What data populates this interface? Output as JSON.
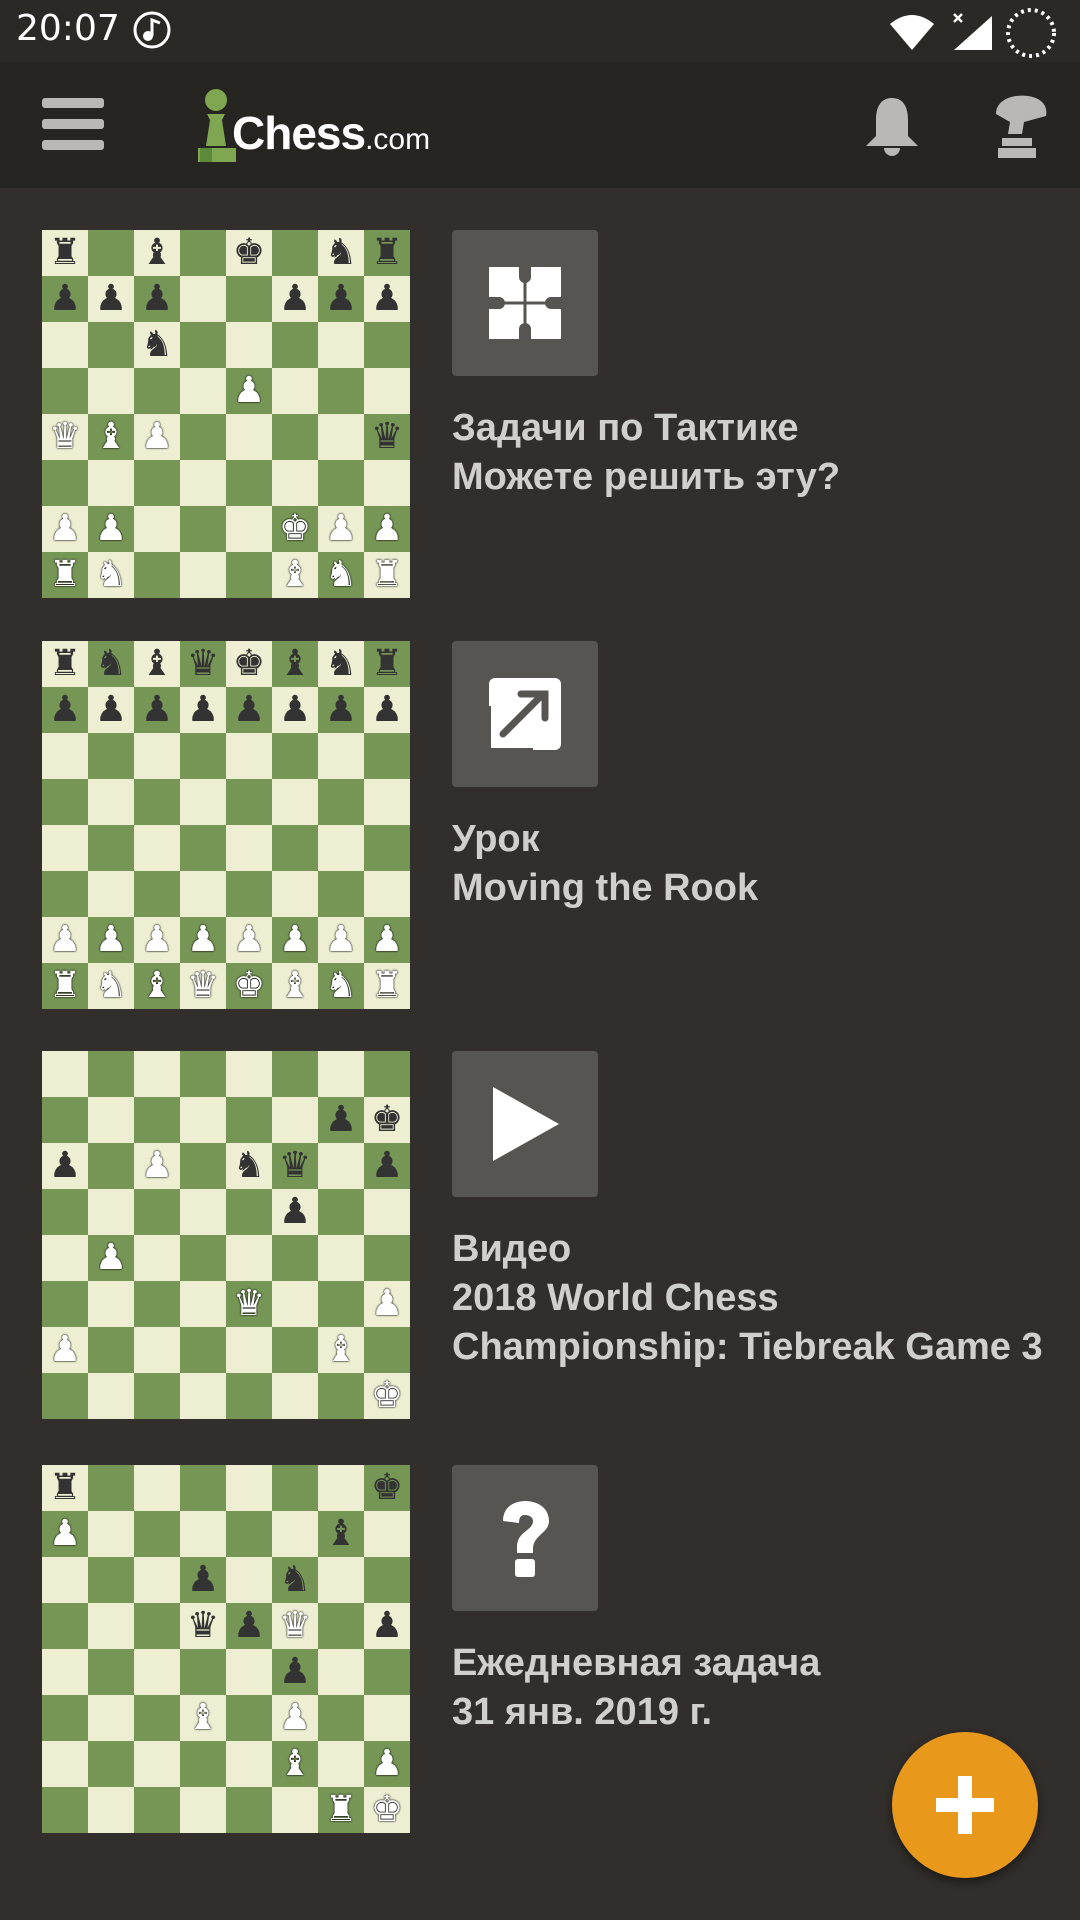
{
  "status_bar": {
    "time": "20:07",
    "icons": [
      "music-note-icon",
      "wifi-icon",
      "signal-icon",
      "battery-loading-icon"
    ]
  },
  "app_bar": {
    "logo_text": "Chess",
    "logo_domain": ".com",
    "icons": [
      "menu-icon",
      "bell-icon",
      "avatar-icon"
    ]
  },
  "board_colors": {
    "light": "#eeeed2",
    "dark": "#769656"
  },
  "feed": [
    {
      "icon": "puzzle-icon",
      "title": "Задачи по Тактике",
      "subtitle": "Можете решить эту?",
      "board": [
        "r.b.k.nr",
        "ppp..ppp",
        "..n.....",
        "....P...",
        "QBP....q",
        "........",
        "PP...KPP",
        "RN...BNR"
      ]
    },
    {
      "icon": "external-link-icon",
      "title": "Урок",
      "subtitle": "Moving the Rook",
      "board": [
        "rnbqkbnr",
        "pppppppp",
        "........",
        "........",
        "........",
        "........",
        "PPPPPPPP",
        "RNBQKBNR"
      ]
    },
    {
      "icon": "play-icon",
      "title": "Видео",
      "subtitle": "2018 World Chess Championship: Tiebreak Game 3",
      "board": [
        "........",
        "......pk",
        "p.P.nq.p",
        ".....p..",
        ".P......",
        "....Q..P",
        "P.....B.",
        ".......K"
      ]
    },
    {
      "icon": "question-icon",
      "title": "Ежедневная задача",
      "subtitle": "31 янв. 2019 г.",
      "board": [
        "r......k",
        "P.....b.",
        "...p.n..",
        "...qpQ.p",
        ".....p..",
        "...B.P..",
        ".....B.P",
        "......RK"
      ]
    }
  ],
  "fab": {
    "icon": "plus-icon"
  }
}
